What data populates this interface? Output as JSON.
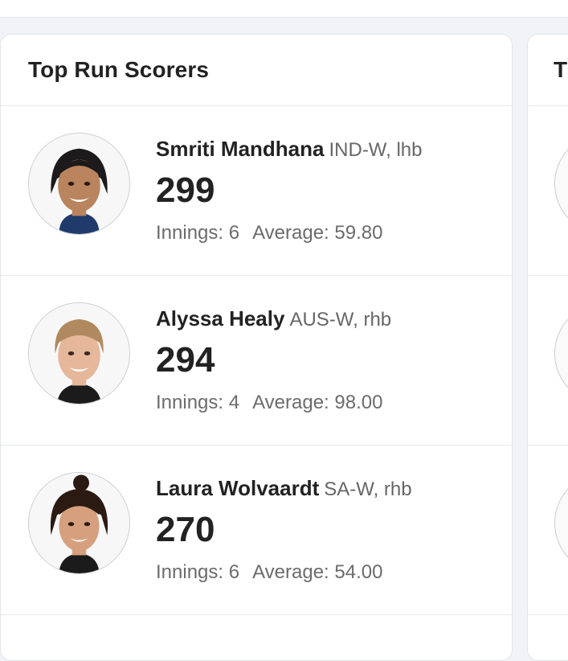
{
  "card": {
    "title": "Top Run Scorers",
    "players": [
      {
        "name": "Smriti Mandhana",
        "team": "IND-W, lhb",
        "runs": "299",
        "innings": "Innings: 6",
        "average": "Average: 59.80"
      },
      {
        "name": "Alyssa Healy",
        "team": "AUS-W, rhb",
        "runs": "294",
        "innings": "Innings: 4",
        "average": "Average: 98.00"
      },
      {
        "name": "Laura Wolvaardt",
        "team": "SA-W, rhb",
        "runs": "270",
        "innings": "Innings: 6",
        "average": "Average: 54.00"
      }
    ]
  },
  "next_card": {
    "title_partial": "T"
  },
  "colors": {
    "background": "#f1f3f6",
    "card": "#ffffff",
    "border": "#e2e5e9",
    "muted_text": "#6b6b6b"
  }
}
